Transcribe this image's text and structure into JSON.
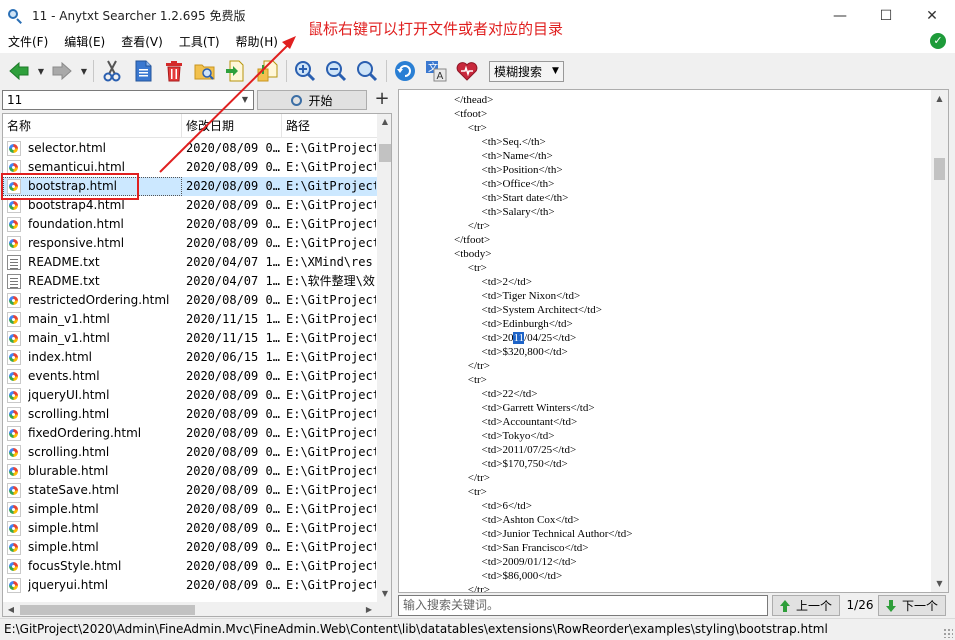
{
  "window": {
    "title": "11 - Anytxt Searcher 1.2.695 免费版",
    "minimize": "—",
    "maximize": "☐",
    "close": "✕"
  },
  "menu": [
    "文件(F)",
    "编辑(E)",
    "查看(V)",
    "工具(T)",
    "帮助(H)"
  ],
  "status_ok": "✓",
  "toolbar": {
    "mode_label": "模糊搜索"
  },
  "search": {
    "value": "11",
    "start_label": "开始",
    "add_label": "+"
  },
  "list": {
    "columns": [
      "名称",
      "修改日期",
      "路径"
    ],
    "rows": [
      {
        "name": "selector.html",
        "date": "2020/08/09 0…",
        "path": "E:\\GitProject",
        "type": "html"
      },
      {
        "name": "semanticui.html",
        "date": "2020/08/09 0…",
        "path": "E:\\GitProject",
        "type": "html"
      },
      {
        "name": "bootstrap.html",
        "date": "2020/08/09 0…",
        "path": "E:\\GitProject",
        "type": "html",
        "selected": true
      },
      {
        "name": "bootstrap4.html",
        "date": "2020/08/09 0…",
        "path": "E:\\GitProject",
        "type": "html"
      },
      {
        "name": "foundation.html",
        "date": "2020/08/09 0…",
        "path": "E:\\GitProject",
        "type": "html"
      },
      {
        "name": "responsive.html",
        "date": "2020/08/09 0…",
        "path": "E:\\GitProject",
        "type": "html"
      },
      {
        "name": "README.txt",
        "date": "2020/04/07 1…",
        "path": "E:\\XMind\\res",
        "type": "txt"
      },
      {
        "name": "README.txt",
        "date": "2020/04/07 1…",
        "path": "E:\\软件整理\\效",
        "type": "txt"
      },
      {
        "name": "restrictedOrdering.html",
        "date": "2020/08/09 0…",
        "path": "E:\\GitProject",
        "type": "html"
      },
      {
        "name": "main_v1.html",
        "date": "2020/11/15 1…",
        "path": "E:\\GitProject",
        "type": "html"
      },
      {
        "name": "main_v1.html",
        "date": "2020/11/15 1…",
        "path": "E:\\GitProject",
        "type": "html"
      },
      {
        "name": "index.html",
        "date": "2020/06/15 1…",
        "path": "E:\\GitProject",
        "type": "html"
      },
      {
        "name": "events.html",
        "date": "2020/08/09 0…",
        "path": "E:\\GitProject",
        "type": "html"
      },
      {
        "name": "jqueryUI.html",
        "date": "2020/08/09 0…",
        "path": "E:\\GitProject",
        "type": "html"
      },
      {
        "name": "scrolling.html",
        "date": "2020/08/09 0…",
        "path": "E:\\GitProject",
        "type": "html"
      },
      {
        "name": "fixedOrdering.html",
        "date": "2020/08/09 0…",
        "path": "E:\\GitProject",
        "type": "html"
      },
      {
        "name": "scrolling.html",
        "date": "2020/08/09 0…",
        "path": "E:\\GitProject",
        "type": "html"
      },
      {
        "name": "blurable.html",
        "date": "2020/08/09 0…",
        "path": "E:\\GitProject",
        "type": "html"
      },
      {
        "name": "stateSave.html",
        "date": "2020/08/09 0…",
        "path": "E:\\GitProject",
        "type": "html"
      },
      {
        "name": "simple.html",
        "date": "2020/08/09 0…",
        "path": "E:\\GitProject",
        "type": "html"
      },
      {
        "name": "simple.html",
        "date": "2020/08/09 0…",
        "path": "E:\\GitProject",
        "type": "html"
      },
      {
        "name": "simple.html",
        "date": "2020/08/09 0…",
        "path": "E:\\GitProject",
        "type": "html"
      },
      {
        "name": "focusStyle.html",
        "date": "2020/08/09 0…",
        "path": "E:\\GitProject",
        "type": "html"
      },
      {
        "name": "jqueryui.html",
        "date": "2020/08/09 0…",
        "path": "E:\\GitProject",
        "type": "html"
      }
    ]
  },
  "code": {
    "lines": [
      "                    </thead>",
      "                    <tfoot>",
      "                         <tr>",
      "                              <th>Seq.</th>",
      "                              <th>Name</th>",
      "                              <th>Position</th>",
      "                              <th>Office</th>",
      "                              <th>Start date</th>",
      "                              <th>Salary</th>",
      "                         </tr>",
      "                    </tfoot>",
      "                    <tbody>",
      "                         <tr>",
      "                              <td>2</td>",
      "                              <td>Tiger Nixon</td>",
      "                              <td>System Architect</td>",
      "                              <td>Edinburgh</td>",
      "                              <td>2011/04/25</td>",
      "                              <td>$320,800</td>",
      "                         </tr>",
      "                         <tr>",
      "                              <td>22</td>",
      "                              <td>Garrett Winters</td>",
      "                              <td>Accountant</td>",
      "                              <td>Tokyo</td>",
      "                              <td>2011/07/25</td>",
      "                              <td>$170,750</td>",
      "                         </tr>",
      "                         <tr>",
      "                              <td>6</td>",
      "                              <td>Ashton Cox</td>",
      "                              <td>Junior Technical Author</td>",
      "                              <td>San Francisco</td>",
      "                              <td>2009/01/12</td>",
      "                              <td>$86,000</td>",
      "                         </tr>"
    ],
    "highlight_line": 17,
    "highlight_text": "11"
  },
  "find": {
    "placeholder": "输入搜索关键词。",
    "prev_label": "上一个",
    "count": "1/26",
    "next_label": "下一个"
  },
  "status": {
    "path": "E:\\GitProject\\2020\\Admin\\FineAdmin.Mvc\\FineAdmin.Web\\Content\\lib\\datatables\\extensions\\RowReorder\\examples\\styling\\bootstrap.html"
  },
  "annotation": {
    "text": "鼠标右键可以打开文件或者对应的目录",
    "color": "#e02020"
  }
}
